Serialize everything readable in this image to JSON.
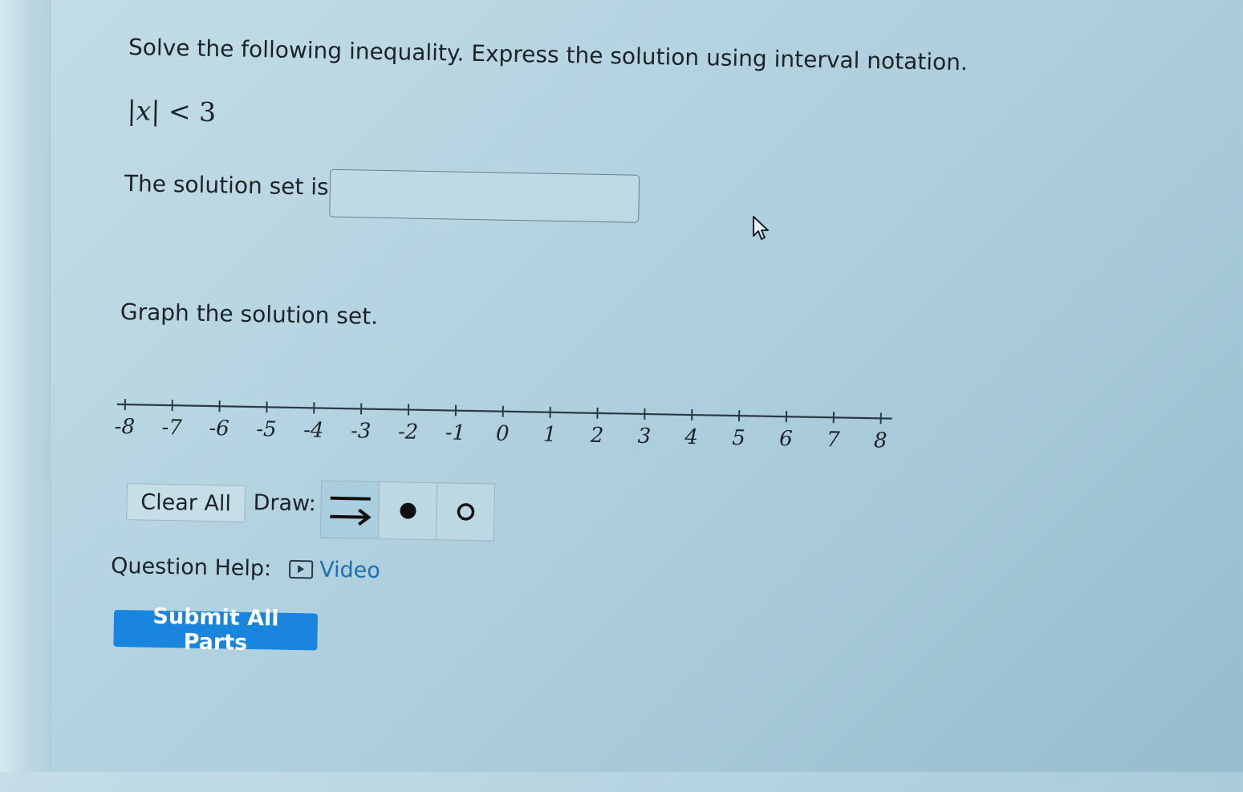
{
  "question": {
    "instruction": "Solve the following inequality. Express the solution using interval notation.",
    "inequality": {
      "lhs_bar_open": "|",
      "variable": "x",
      "lhs_bar_close": "|",
      "operator": "<",
      "rhs": "3"
    },
    "solution_label": "The solution set is",
    "solution_value": "",
    "graph_label": "Graph the solution set."
  },
  "number_line": {
    "min": -8,
    "max": 8,
    "ticks": [
      "-8",
      "-7",
      "-6",
      "-5",
      "-4",
      "-3",
      "-2",
      "-1",
      "0",
      "1",
      "2",
      "3",
      "4",
      "5",
      "6",
      "7",
      "8"
    ]
  },
  "tools": {
    "clear_label": "Clear All",
    "draw_label": "Draw:",
    "items": [
      "ray-tool-icon",
      "closed-dot-icon",
      "open-dot-icon"
    ],
    "active": "ray-tool-icon"
  },
  "help": {
    "label": "Question Help:",
    "video_label": "Video"
  },
  "submit_label": "Submit All Parts",
  "colors": {
    "accent": "#1985df",
    "link": "#1f6fb6"
  }
}
